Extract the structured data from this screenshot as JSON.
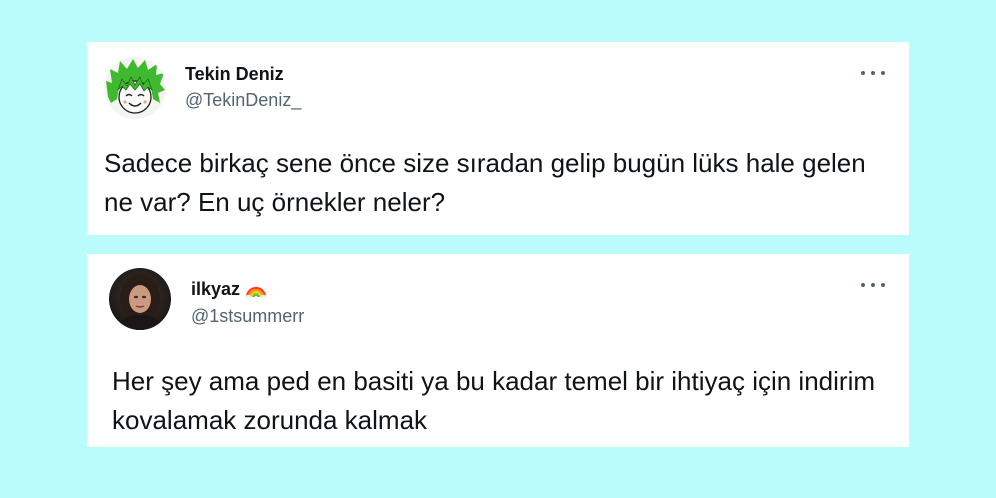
{
  "tweets": [
    {
      "display_name": "Tekin Deniz",
      "handle": "@TekinDeniz_",
      "text": "Sadece birkaç sene önce size sıradan gelip bugün lüks hale gelen ne var? En uç örnekler neler?",
      "avatar_icon": "green-hair-cartoon-avatar"
    },
    {
      "display_name": "ilkyaz",
      "display_name_emoji": "rainbow-icon",
      "handle": "@1stsummerr",
      "text": "Her şey ama ped en basiti ya bu kadar temel bir ihtiyaç için indirim kovalamak zorunda kalmak",
      "avatar_icon": "dark-photo-avatar"
    }
  ],
  "colors": {
    "background": "#b9fcfb",
    "card": "#ffffff",
    "text": "#0f1419",
    "secondary_text": "#536471"
  }
}
